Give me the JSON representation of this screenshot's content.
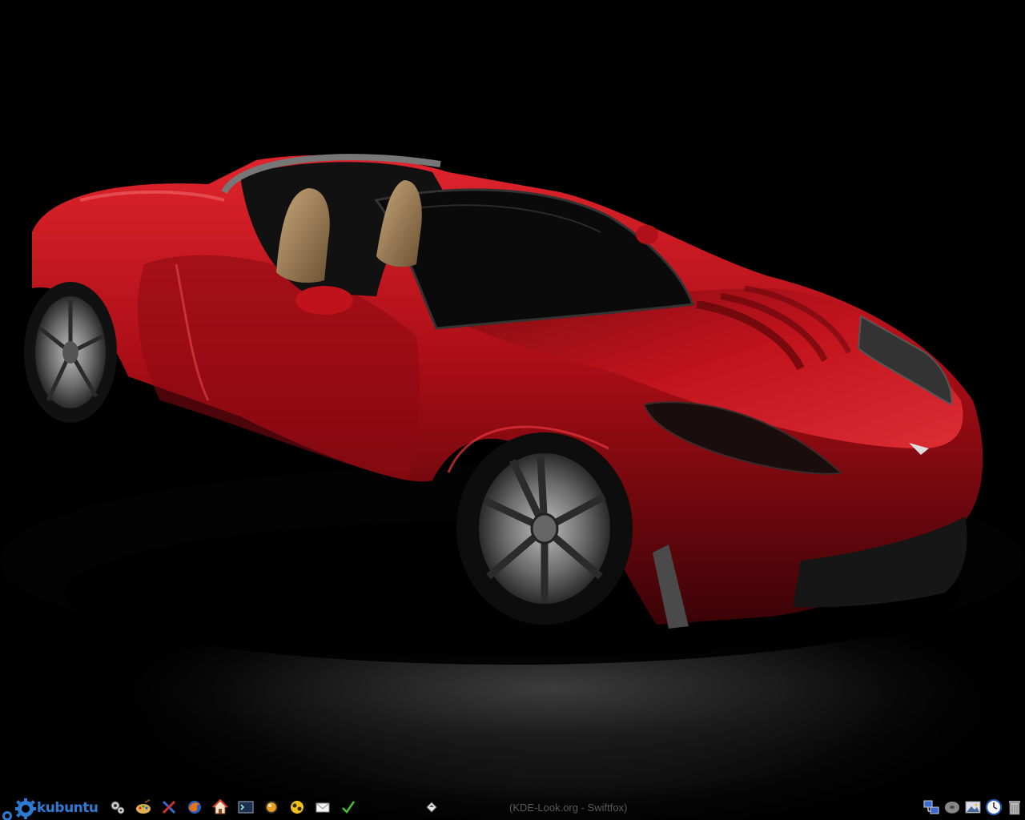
{
  "wallpaper": {
    "subject": "red roadster sports car",
    "body_color": "#b0121a",
    "background_color": "#000000"
  },
  "panel": {
    "kmenu": {
      "label": "kubuntu",
      "icon": "kubuntu-gear-icon",
      "color": "#2e7bd4"
    },
    "launchers": [
      {
        "icon": "system-settings-icon"
      },
      {
        "icon": "paint-palette-icon"
      },
      {
        "icon": "tools-icon"
      },
      {
        "icon": "firefox-browser-icon"
      },
      {
        "icon": "home-folder-icon"
      },
      {
        "icon": "terminal-icon"
      },
      {
        "icon": "amarok-media-icon"
      },
      {
        "icon": "kopete-messenger-icon"
      },
      {
        "icon": "mail-icon"
      },
      {
        "icon": "checkmark-icon"
      }
    ],
    "taskbar": {
      "task_icon": "window-app-icon",
      "active_task_title": "(KDE-Look.org - Swiftfox)"
    },
    "systray": [
      {
        "icon": "network-icon"
      },
      {
        "icon": "disk-icon"
      },
      {
        "icon": "image-viewer-icon"
      },
      {
        "icon": "clock-icon"
      },
      {
        "icon": "trash-icon"
      }
    ]
  }
}
